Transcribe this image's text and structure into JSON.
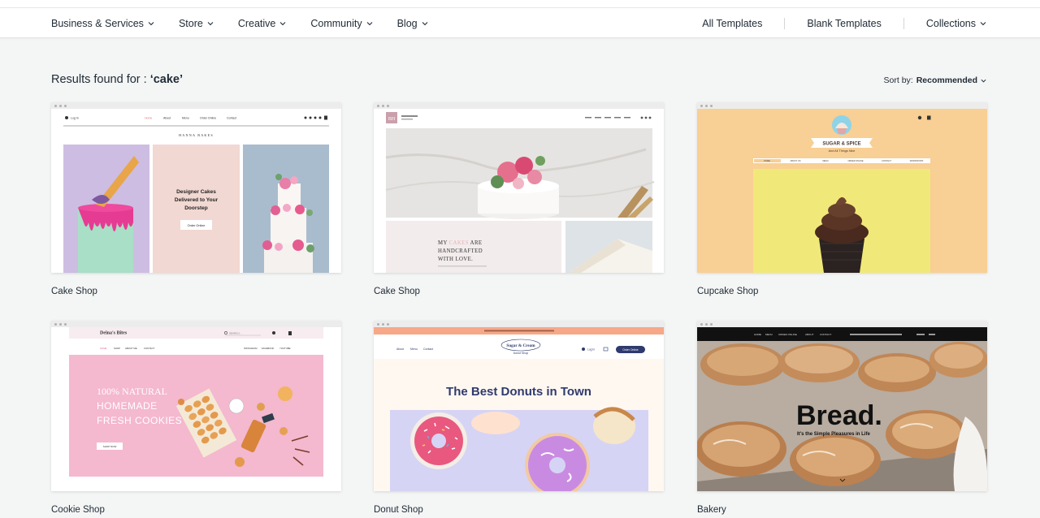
{
  "nav": {
    "left": [
      "Business & Services",
      "Store",
      "Creative",
      "Community",
      "Blog"
    ],
    "all_templates": "All Templates",
    "blank_templates": "Blank Templates",
    "collections": "Collections"
  },
  "results": {
    "prefix": "Results found for : ",
    "query": "‘cake’"
  },
  "sort": {
    "label": "Sort by:",
    "value": "Recommended"
  },
  "cards": [
    {
      "title": "Cake Shop",
      "preview": {
        "brand": "HANNA BAKES",
        "headline": "Designer Cakes Delivered to Your Doorstep",
        "cta": "Order Online",
        "menu": [
          "Home",
          "About",
          "Menu",
          "Order Online",
          "Contact"
        ],
        "login": "Log In"
      }
    },
    {
      "title": "Cake Shop",
      "preview": {
        "logo": "BH",
        "text": "MY CAKES ARE HANDCRAFTED WITH LOVE."
      }
    },
    {
      "title": "Cupcake Shop",
      "preview": {
        "brand": "SUGAR & SPICE",
        "tagline": "And All Things Nice",
        "menu": [
          "HOME",
          "ABOUT US",
          "MENU",
          "ORDER ONLINE",
          "CONTACT",
          "WORKSHOPS"
        ]
      }
    },
    {
      "title": "Cookie Shop",
      "preview": {
        "brand": "Deina's Bites",
        "search": "SEARCH...",
        "headline_1": "100% NATURAL",
        "headline_2": "HOMEMADE",
        "headline_3": "FRESH COOKIES",
        "cta": "SHOP NOW",
        "menu": [
          "HOME",
          "SHOP",
          "ABOUT ME",
          "CONTACT"
        ],
        "social": [
          "INSTAGRAM",
          "FACEBOOK",
          "YOUTUBE"
        ]
      }
    },
    {
      "title": "Donut Shop",
      "preview": {
        "brand": "Sugar & Cream",
        "sub": "Donut Shop",
        "headline": "The Best Donuts in Town",
        "cta": "Order Online",
        "menu": [
          "About",
          "Menu",
          "Contact"
        ],
        "login": "Log In"
      }
    },
    {
      "title": "Bakery",
      "preview": {
        "headline": "Bread.",
        "tagline": "It's the Simple Pleasures in Life",
        "menu": [
          "HOME",
          "MENU",
          "ORDER ONLINE",
          "ABOUT",
          "CONTACT"
        ]
      }
    }
  ],
  "colors": {
    "bg": "#f4f5f5",
    "text": "#1f2a35",
    "donut_navy": "#2f3a6e",
    "cupcake_bg": "#f8cf94",
    "cupcake_yellow": "#f1e87a"
  }
}
